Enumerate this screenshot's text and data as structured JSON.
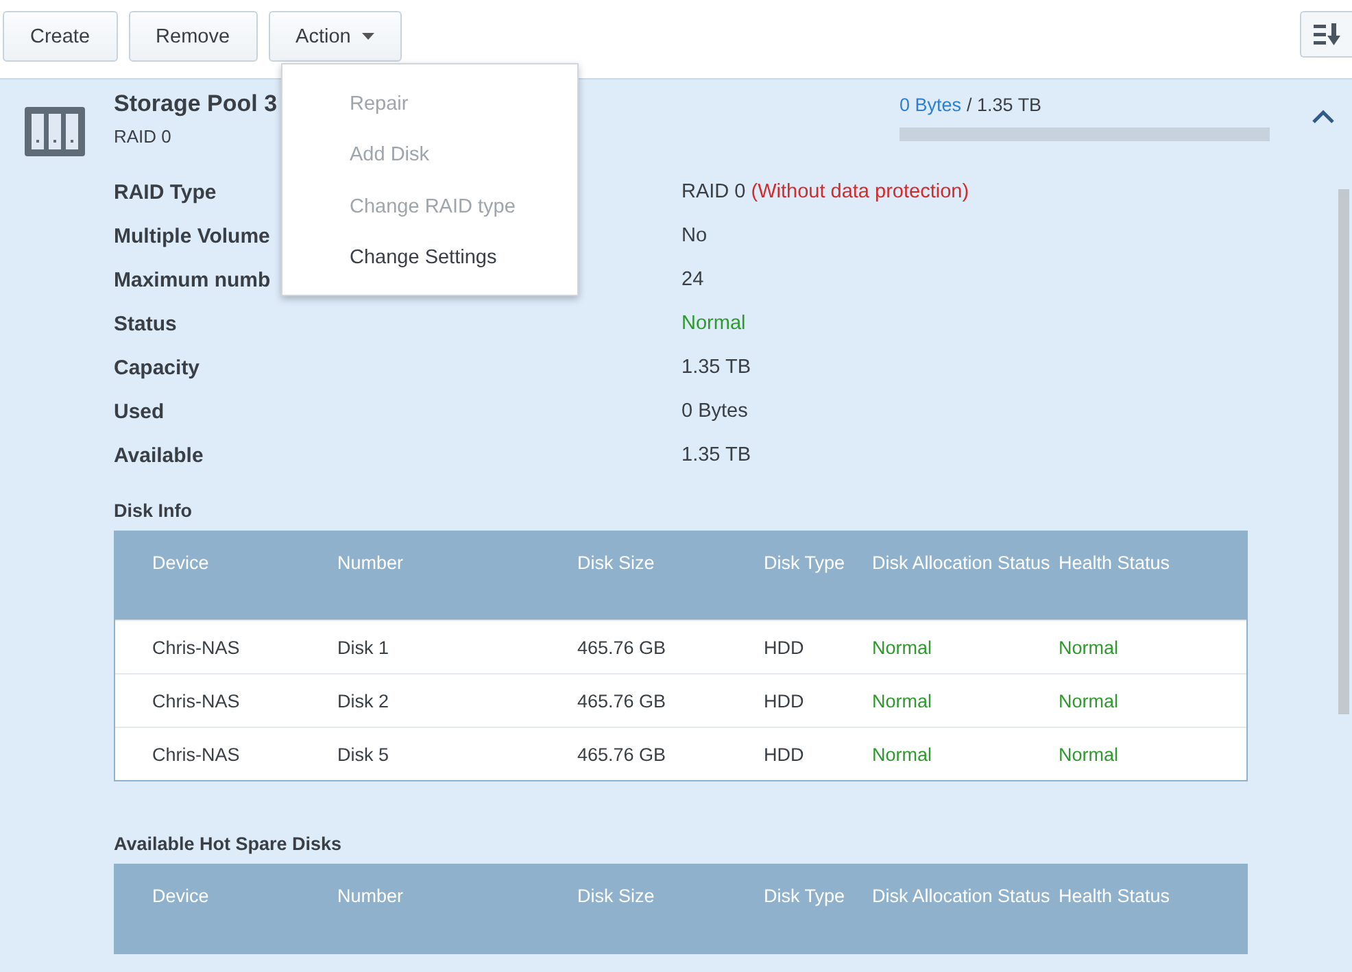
{
  "toolbar": {
    "buttons": [
      {
        "label": "Create"
      },
      {
        "label": "Remove"
      },
      {
        "label": "Action"
      }
    ]
  },
  "action_menu": {
    "items": [
      {
        "label": "Repair",
        "disabled": true
      },
      {
        "label": "Add Disk",
        "disabled": true
      },
      {
        "label": "Change RAID type",
        "disabled": true
      },
      {
        "label": "Change Settings",
        "disabled": false
      }
    ]
  },
  "pool": {
    "title": "Storage Pool 3",
    "subtitle": "RAID 0",
    "usage": "0 Bytes",
    "capacity": "/ 1.35 TB",
    "level": 0,
    "expanded": true,
    "details": [
      {
        "label": "RAID Type",
        "value": "RAID 0",
        "note": "(Without data protection)",
        "kind": "plain"
      },
      {
        "label": "Multiple Volume",
        "value": "No",
        "kind": "plain"
      },
      {
        "label": "Maximum numb",
        "value": "24",
        "kind": "plain"
      },
      {
        "label": "Status",
        "value": "Normal",
        "kind": "good"
      },
      {
        "label": "Capacity",
        "value": "1.35 TB",
        "kind": "plain"
      },
      {
        "label": "Used",
        "value": "0 Bytes",
        "kind": "plain"
      },
      {
        "label": "Available",
        "value": "1.35 TB",
        "kind": "plain"
      }
    ]
  },
  "disk_info": {
    "title": "Disk Info",
    "columns": [
      "Device",
      "Number",
      "Disk Size",
      "Disk Type",
      "Disk Allocation Status",
      "Health Status"
    ],
    "rows": [
      [
        "Chris-NAS",
        "Disk 1",
        "465.76 GB",
        "HDD",
        "Normal",
        "Normal"
      ],
      [
        "Chris-NAS",
        "Disk 2",
        "465.76 GB",
        "HDD",
        "Normal",
        "Normal"
      ],
      [
        "Chris-NAS",
        "Disk 5",
        "465.76 GB",
        "HDD",
        "Normal",
        "Normal"
      ]
    ]
  },
  "hot_spare": {
    "title": "Available Hot Spare Disks",
    "columns": [
      "Device",
      "Number",
      "Disk Size",
      "Disk Type",
      "Disk Allocation Status",
      "Health Status"
    ]
  }
}
